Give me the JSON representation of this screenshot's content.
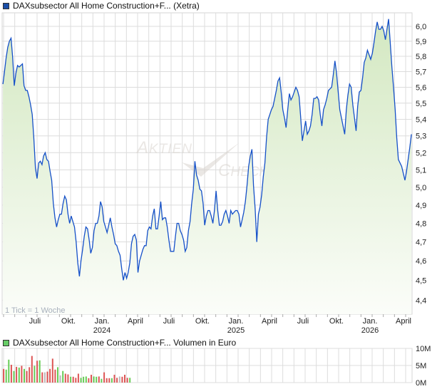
{
  "chart_data": [
    {
      "type": "area",
      "title": "DAXsubsector All Home Construction+F... (Xetra)",
      "series_color": "#1550c8",
      "legend_color": "#1a4fa8",
      "fill_top": "#d3e8c1",
      "fill_bottom": "#fbfdf9",
      "x_start_year": 2023.245,
      "x_end_year": 2026.293,
      "y_scale": "log",
      "ylim": [
        4.35,
        6.07
      ],
      "y_ticks": [
        "6,0",
        "5,9",
        "5,8",
        "5,7",
        "5,6",
        "5,5",
        "5,4",
        "5,3",
        "5,2",
        "5,1",
        "5,0",
        "4,9",
        "4,8",
        "4,7",
        "4,6",
        "4,5",
        "4,4"
      ],
      "y_tick_values": [
        6.0,
        5.9,
        5.8,
        5.7,
        5.6,
        5.5,
        5.4,
        5.3,
        5.2,
        5.1,
        5.0,
        4.9,
        4.8,
        4.7,
        4.6,
        4.5,
        4.4
      ],
      "x_ticks": [
        {
          "label": "Juli",
          "sub": "",
          "year": 2023.5
        },
        {
          "label": "Okt.",
          "sub": "",
          "year": 2023.75
        },
        {
          "label": "Jan.",
          "sub": "2024",
          "year": 2024.0
        },
        {
          "label": "April",
          "sub": "",
          "year": 2024.25
        },
        {
          "label": "Juli",
          "sub": "",
          "year": 2024.5
        },
        {
          "label": "Okt.",
          "sub": "",
          "year": 2024.75
        },
        {
          "label": "Jan.",
          "sub": "2025",
          "year": 2025.0
        },
        {
          "label": "April",
          "sub": "",
          "year": 2025.25
        },
        {
          "label": "Juli",
          "sub": "",
          "year": 2025.5
        },
        {
          "label": "Okt.",
          "sub": "",
          "year": 2025.75
        },
        {
          "label": "Jan.",
          "sub": "2026",
          "year": 2026.0
        },
        {
          "label": "April",
          "sub": "",
          "year": 2026.25
        }
      ],
      "note": "1 Tick = 1 Woche",
      "watermark": "AKTIEN CHECK",
      "values": [
        5.62,
        5.7,
        5.79,
        5.86,
        5.9,
        5.92,
        5.79,
        5.61,
        5.69,
        5.74,
        5.73,
        5.74,
        5.75,
        5.61,
        5.58,
        5.58,
        5.54,
        5.49,
        5.43,
        5.29,
        5.11,
        5.05,
        5.14,
        5.15,
        5.13,
        5.18,
        5.2,
        5.16,
        5.15,
        5.09,
        5.04,
        4.91,
        4.83,
        4.78,
        4.82,
        4.85,
        4.85,
        4.91,
        4.95,
        4.93,
        4.85,
        4.8,
        4.84,
        4.81,
        4.78,
        4.7,
        4.59,
        4.52,
        4.6,
        4.66,
        4.73,
        4.78,
        4.77,
        4.71,
        4.64,
        4.67,
        4.76,
        4.8,
        4.8,
        4.84,
        4.92,
        4.89,
        4.81,
        4.78,
        4.75,
        4.79,
        4.83,
        4.78,
        4.74,
        4.69,
        4.68,
        4.65,
        4.63,
        4.56,
        4.5,
        4.54,
        4.51,
        4.54,
        4.59,
        4.69,
        4.73,
        4.74,
        4.71,
        4.54,
        4.6,
        4.63,
        4.66,
        4.68,
        4.68,
        4.76,
        4.78,
        4.77,
        4.84,
        4.88,
        4.77,
        4.77,
        4.84,
        4.92,
        4.82,
        4.83,
        4.83,
        4.78,
        4.71,
        4.65,
        4.65,
        4.65,
        4.73,
        4.8,
        4.8,
        4.76,
        4.74,
        4.71,
        4.65,
        4.67,
        4.76,
        4.81,
        4.91,
        4.99,
        5.15,
        5.07,
        5.04,
        4.99,
        4.98,
        4.91,
        4.79,
        4.84,
        4.87,
        4.87,
        4.84,
        4.8,
        4.87,
        4.98,
        4.87,
        4.79,
        4.79,
        4.81,
        4.85,
        4.87,
        4.84,
        4.8,
        4.87,
        4.85,
        4.86,
        4.87,
        4.87,
        4.85,
        4.78,
        4.82,
        4.86,
        4.92,
        5.01,
        5.12,
        5.18,
        5.22,
        5.01,
        4.88,
        4.7,
        4.85,
        4.89,
        4.96,
        5.06,
        5.14,
        5.29,
        5.4,
        5.43,
        5.46,
        5.48,
        5.53,
        5.58,
        5.64,
        5.66,
        5.57,
        5.46,
        5.41,
        5.35,
        5.46,
        5.56,
        5.52,
        5.54,
        5.57,
        5.6,
        5.58,
        5.54,
        5.41,
        5.27,
        5.33,
        5.39,
        5.31,
        5.33,
        5.36,
        5.43,
        5.53,
        5.53,
        5.54,
        5.52,
        5.43,
        5.36,
        5.46,
        5.49,
        5.53,
        5.58,
        5.59,
        5.6,
        5.68,
        5.77,
        5.69,
        5.57,
        5.46,
        5.41,
        5.36,
        5.31,
        5.46,
        5.55,
        5.62,
        5.6,
        5.49,
        5.41,
        5.33,
        5.48,
        5.57,
        5.58,
        5.66,
        5.76,
        5.79,
        5.84,
        5.81,
        5.78,
        5.82,
        5.89,
        5.97,
        6.03,
        5.98,
        5.98,
        6.0,
        5.97,
        5.91,
        5.98,
        6.05,
        5.89,
        5.73,
        5.6,
        5.46,
        5.29,
        5.16,
        5.14,
        5.12,
        5.08,
        5.04,
        5.09,
        5.16,
        5.23,
        5.31
      ]
    },
    {
      "type": "bar",
      "title": "DAXsubsector All Home Construction+F... Volumen in Euro",
      "legend_color": "#66cc66",
      "colors": {
        "up": "#66cc55",
        "down": "#dd5555",
        "flat": "#bbbbbb"
      },
      "x_start_year": 2023.245,
      "bar_interval_weeks": 1,
      "ylim": [
        0,
        10
      ],
      "unit": "M",
      "y_ticks": [
        "10M",
        "5M",
        "0M"
      ],
      "y_tick_values": [
        10,
        5,
        0
      ],
      "values": [
        4.0,
        3.8,
        6.7,
        5.2,
        3.4,
        4.6,
        4.4,
        4.9,
        4.0,
        3.4,
        4.5,
        7.8,
        4.9,
        6.4,
        6.5,
        3.0,
        3.0,
        3.2,
        4.0,
        7.0,
        3.8,
        4.5,
        2.1,
        3.4,
        2.6,
        2.4,
        1.7,
        1.7,
        1.4,
        2.6,
        1.4,
        1.7,
        1.8,
        1.3,
        2.3,
        1.8,
        1.7,
        1.8,
        1.1,
        3.0,
        1.3,
        1.3,
        1.3,
        2.3,
        1.4,
        1.8,
        1.7,
        2.3,
        1.4,
        1.4
      ],
      "directions": [
        "down",
        "up",
        "up",
        "down",
        "up",
        "down",
        "up",
        "down",
        "up",
        "down",
        "down",
        "down",
        "up",
        "down",
        "up",
        "down",
        "flat",
        "down",
        "down",
        "down",
        "down",
        "up",
        "flat",
        "up",
        "down",
        "down",
        "up",
        "down",
        "down",
        "down",
        "up",
        "up",
        "up",
        "down",
        "down",
        "up",
        "up",
        "down",
        "up",
        "down",
        "down",
        "down",
        "up",
        "down",
        "down",
        "flat",
        "down",
        "down",
        "down",
        "up"
      ]
    }
  ]
}
